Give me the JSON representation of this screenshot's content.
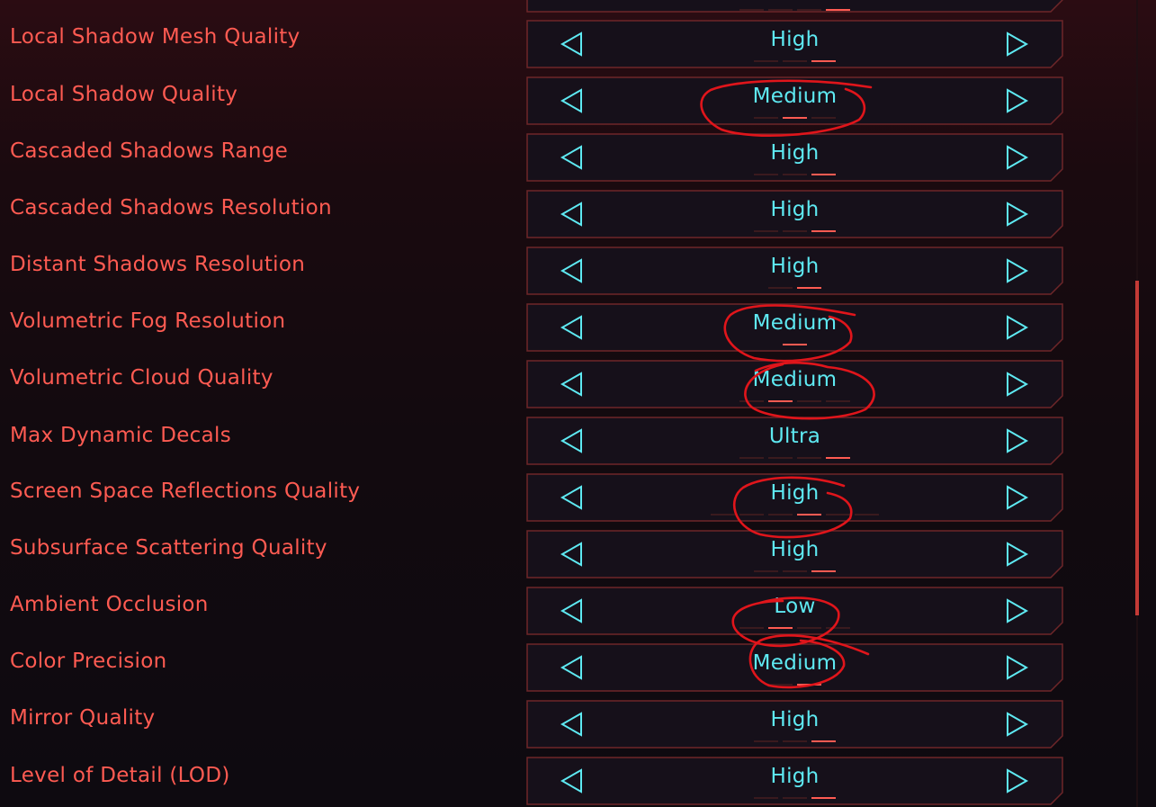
{
  "settings": [
    {
      "label": "Local Shadow Mesh Quality",
      "value": "High",
      "pips": [
        0,
        0,
        1
      ]
    },
    {
      "label": "Local Shadow Quality",
      "value": "Medium",
      "pips": [
        0,
        1,
        0
      ]
    },
    {
      "label": "Cascaded Shadows Range",
      "value": "High",
      "pips": [
        0,
        0,
        1
      ]
    },
    {
      "label": "Cascaded Shadows Resolution",
      "value": "High",
      "pips": [
        0,
        0,
        1
      ]
    },
    {
      "label": "Distant Shadows Resolution",
      "value": "High",
      "pips": [
        0,
        1
      ]
    },
    {
      "label": "Volumetric Fog Resolution",
      "value": "Medium",
      "pips": [
        1
      ]
    },
    {
      "label": "Volumetric Cloud Quality",
      "value": "Medium",
      "pips": [
        0,
        1,
        0,
        0
      ]
    },
    {
      "label": "Max Dynamic Decals",
      "value": "Ultra",
      "pips": [
        0,
        0,
        0,
        1
      ]
    },
    {
      "label": "Screen Space Reflections Quality",
      "value": "High",
      "pips": [
        0,
        0,
        0,
        1,
        0,
        0
      ]
    },
    {
      "label": "Subsurface Scattering Quality",
      "value": "High",
      "pips": [
        0,
        0,
        1
      ]
    },
    {
      "label": "Ambient Occlusion",
      "value": "Low",
      "pips": [
        0,
        1,
        0,
        0
      ]
    },
    {
      "label": "Color Precision",
      "value": "Medium",
      "pips": [
        0,
        1
      ]
    },
    {
      "label": "Mirror Quality",
      "value": "High",
      "pips": [
        0,
        0,
        1
      ]
    },
    {
      "label": "Level of Detail (LOD)",
      "value": "High",
      "pips": [
        0,
        0,
        1
      ]
    }
  ],
  "icons": {
    "decrease": "triangle-left-icon",
    "increase": "triangle-right-icon"
  },
  "colors": {
    "label": "#ff5b52",
    "value": "#5ee9f2",
    "frame": "#7a2a2c",
    "annotation": "#e0151b",
    "pip_active": "#ff5b52"
  },
  "scrollbar": {
    "position": 0.35
  },
  "annotations": {
    "circled_values": [
      "Local Shadow Quality",
      "Volumetric Fog Resolution",
      "Volumetric Cloud Quality",
      "Screen Space Reflections Quality",
      "Ambient Occlusion",
      "Color Precision"
    ]
  }
}
